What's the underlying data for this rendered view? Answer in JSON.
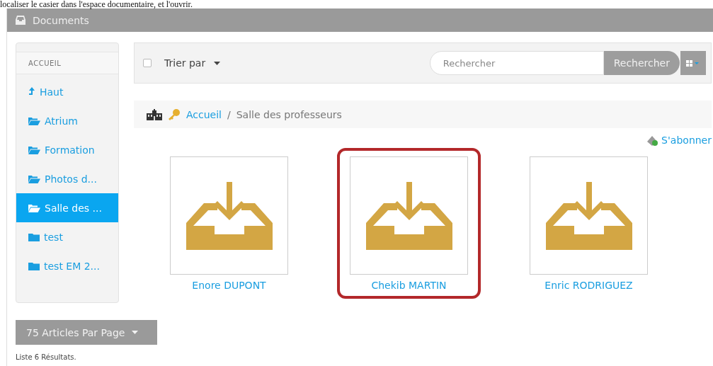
{
  "caption": "localiser le casier dans l'espace documentaire, et l'ouvrir.",
  "window": {
    "title": "Documents"
  },
  "sidebar": {
    "heading": "ACCUEIL",
    "items": [
      {
        "label": "Haut",
        "kind": "up",
        "selected": false
      },
      {
        "label": "Atrium",
        "kind": "folder-open",
        "selected": false
      },
      {
        "label": "Formation",
        "kind": "folder-open",
        "selected": false
      },
      {
        "label": "Photos d...",
        "kind": "folder-open",
        "selected": false
      },
      {
        "label": "Salle des ...",
        "kind": "folder-open",
        "selected": true
      },
      {
        "label": "test",
        "kind": "folder",
        "selected": false
      },
      {
        "label": "test EM 2...",
        "kind": "folder",
        "selected": false
      }
    ]
  },
  "toolbar": {
    "select_all": {
      "checked": false
    },
    "sort": "Trier par",
    "search": {
      "placeholder": "Rechercher"
    },
    "search_button": "Rechercher"
  },
  "breadcrumb": [
    {
      "label": "Accueil",
      "kind": "link"
    },
    {
      "label": "/",
      "kind": "separator"
    },
    {
      "label": "Salle des professeurs",
      "kind": "current"
    }
  ],
  "subscribe": "S'abonner",
  "folders": [
    {
      "label": "Enore DUPONT",
      "highlighted": false
    },
    {
      "label": "Chekib MARTIN",
      "highlighted": true
    },
    {
      "label": "Enric RODRIGUEZ",
      "highlighted": false
    }
  ],
  "pager": "75 Articles Par Page",
  "result_count": "Liste 6 Résultats."
}
